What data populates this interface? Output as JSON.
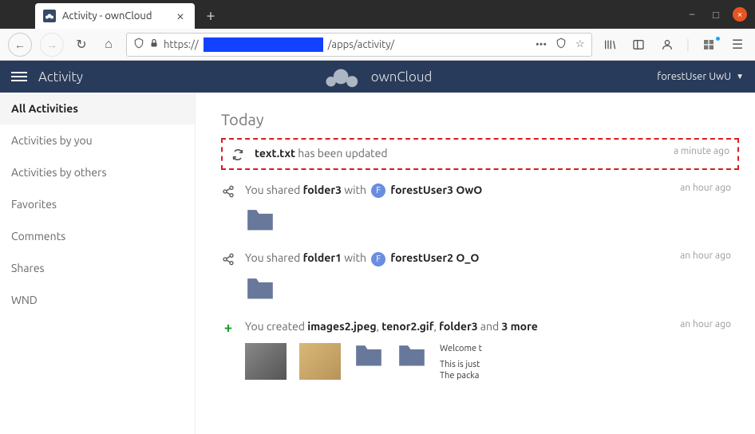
{
  "browser": {
    "tab_title": "Activity - ownCloud",
    "url_prefix": "https://",
    "url_suffix": "/apps/activity/"
  },
  "header": {
    "app_name": "Activity",
    "brand": "ownCloud",
    "user": "forestUser UwU"
  },
  "sidebar": {
    "items": [
      {
        "label": "All Activities",
        "active": true
      },
      {
        "label": "Activities by you"
      },
      {
        "label": "Activities by others"
      },
      {
        "label": "Favorites"
      },
      {
        "label": "Comments"
      },
      {
        "label": "Shares"
      },
      {
        "label": "WND"
      }
    ]
  },
  "feed": {
    "day": "Today",
    "items": [
      {
        "icon": "sync",
        "highlight": true,
        "time": "a minute ago",
        "bold1": "text.txt",
        "rest": " has been updated"
      },
      {
        "icon": "share",
        "time": "an hour ago",
        "pre": "You shared ",
        "bold1": "folder3",
        "mid": " with ",
        "avatar": "F",
        "bold2": "forestUser3 OwO",
        "preview": "folder"
      },
      {
        "icon": "share",
        "time": "an hour ago",
        "pre": "You shared ",
        "bold1": "folder1",
        "mid": " with ",
        "avatar": "F",
        "bold2": "forestUser2 O_O",
        "preview": "folder"
      },
      {
        "icon": "plus",
        "time": "an hour ago",
        "pre": "You created ",
        "bold1": "images2.jpeg",
        "sep1": ", ",
        "bold2": "tenor2.gif",
        "sep2": ", ",
        "bold3": "folder3",
        "mid2": " and ",
        "bold4": "3 more",
        "preview": "multi",
        "text_preview_l1": "Welcome t",
        "text_preview_l2": "This is just",
        "text_preview_l3": "The packa"
      }
    ]
  }
}
